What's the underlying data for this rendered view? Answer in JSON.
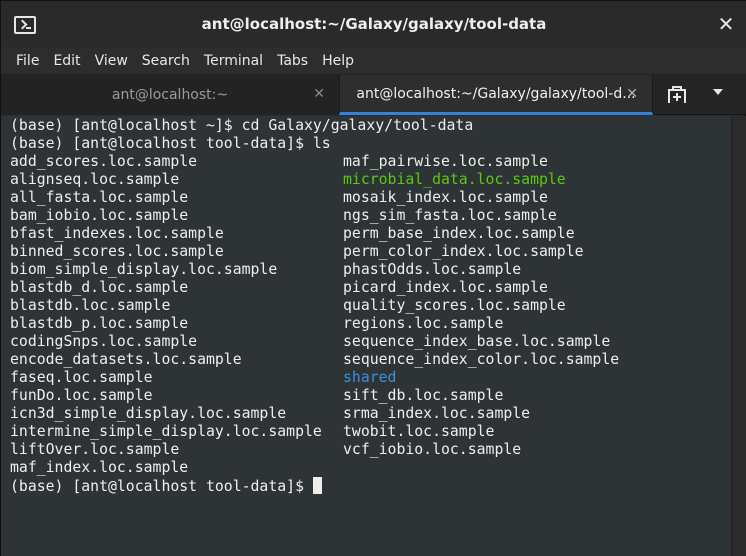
{
  "window": {
    "title": "ant@localhost:~/Galaxy/galaxy/tool-data",
    "close_glyph": "✕"
  },
  "menu": [
    "File",
    "Edit",
    "View",
    "Search",
    "Terminal",
    "Tabs",
    "Help"
  ],
  "tabs": [
    {
      "label": "ant@localhost:~",
      "active": false,
      "close_glyph": "✕"
    },
    {
      "label": "ant@localhost:~/Galaxy/galaxy/tool-d...",
      "active": true,
      "close_glyph": "✕"
    }
  ],
  "terminal": {
    "lines_before": [
      "(base) [ant@localhost ~]$ cd Galaxy/galaxy/tool-data",
      "(base) [ant@localhost tool-data]$ ls"
    ],
    "col1": [
      "add_scores.loc.sample",
      "alignseq.loc.sample",
      "all_fasta.loc.sample",
      "bam_iobio.loc.sample",
      "bfast_indexes.loc.sample",
      "binned_scores.loc.sample",
      "biom_simple_display.loc.sample",
      "blastdb_d.loc.sample",
      "blastdb.loc.sample",
      "blastdb_p.loc.sample",
      "codingSnps.loc.sample",
      "encode_datasets.loc.sample",
      "faseq.loc.sample",
      "funDo.loc.sample",
      "icn3d_simple_display.loc.sample",
      "intermine_simple_display.loc.sample",
      "liftOver.loc.sample",
      "maf_index.loc.sample"
    ],
    "col2": [
      {
        "text": "maf_pairwise.loc.sample",
        "color": "default"
      },
      {
        "text": "microbial_data.loc.sample",
        "color": "green"
      },
      {
        "text": "mosaik_index.loc.sample",
        "color": "default"
      },
      {
        "text": "ngs_sim_fasta.loc.sample",
        "color": "default"
      },
      {
        "text": "perm_base_index.loc.sample",
        "color": "default"
      },
      {
        "text": "perm_color_index.loc.sample",
        "color": "default"
      },
      {
        "text": "phastOdds.loc.sample",
        "color": "default"
      },
      {
        "text": "picard_index.loc.sample",
        "color": "default"
      },
      {
        "text": "quality_scores.loc.sample",
        "color": "default"
      },
      {
        "text": "regions.loc.sample",
        "color": "default"
      },
      {
        "text": "sequence_index_base.loc.sample",
        "color": "default"
      },
      {
        "text": "sequence_index_color.loc.sample",
        "color": "default"
      },
      {
        "text": "shared",
        "color": "blue"
      },
      {
        "text": "sift_db.loc.sample",
        "color": "default"
      },
      {
        "text": "srma_index.loc.sample",
        "color": "default"
      },
      {
        "text": "twobit.loc.sample",
        "color": "default"
      },
      {
        "text": "vcf_iobio.loc.sample",
        "color": "default"
      }
    ],
    "prompt_final": "(base) [ant@localhost tool-data]$ "
  },
  "colors": {
    "terminal_bg": "#2e3436",
    "text": "#eeeeec",
    "green": "#5cc80f",
    "blue": "#3e8fde",
    "accent": "#3583d6"
  },
  "icons": {
    "app": "terminal-icon",
    "new_tab": "new-tab-icon",
    "menu": "chevron-down-icon"
  }
}
